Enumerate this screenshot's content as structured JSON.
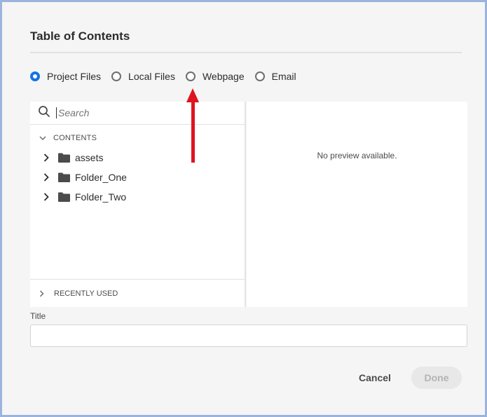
{
  "dialog": {
    "title": "Table of Contents"
  },
  "link_type": {
    "options": [
      {
        "label": "Project Files",
        "checked": true
      },
      {
        "label": "Local Files",
        "checked": false
      },
      {
        "label": "Webpage",
        "checked": false
      },
      {
        "label": "Email",
        "checked": false
      }
    ]
  },
  "browser": {
    "search_placeholder": "Search",
    "contents_label": "CONTENTS",
    "items": [
      {
        "label": "assets"
      },
      {
        "label": "Folder_One"
      },
      {
        "label": "Folder_Two"
      }
    ],
    "recently_used_label": "RECENTLY USED"
  },
  "preview": {
    "empty_text": "No preview available."
  },
  "title_field": {
    "label": "Title",
    "value": ""
  },
  "actions": {
    "cancel_label": "Cancel",
    "done_label": "Done"
  },
  "colors": {
    "accent": "#1473e6",
    "annotation": "#e0141e",
    "frame": "#9bb4dd"
  },
  "icons": {
    "search": "search-icon",
    "folder": "folder-icon",
    "chevron_right": "chevron-right-icon",
    "chevron_down": "chevron-down-icon"
  }
}
